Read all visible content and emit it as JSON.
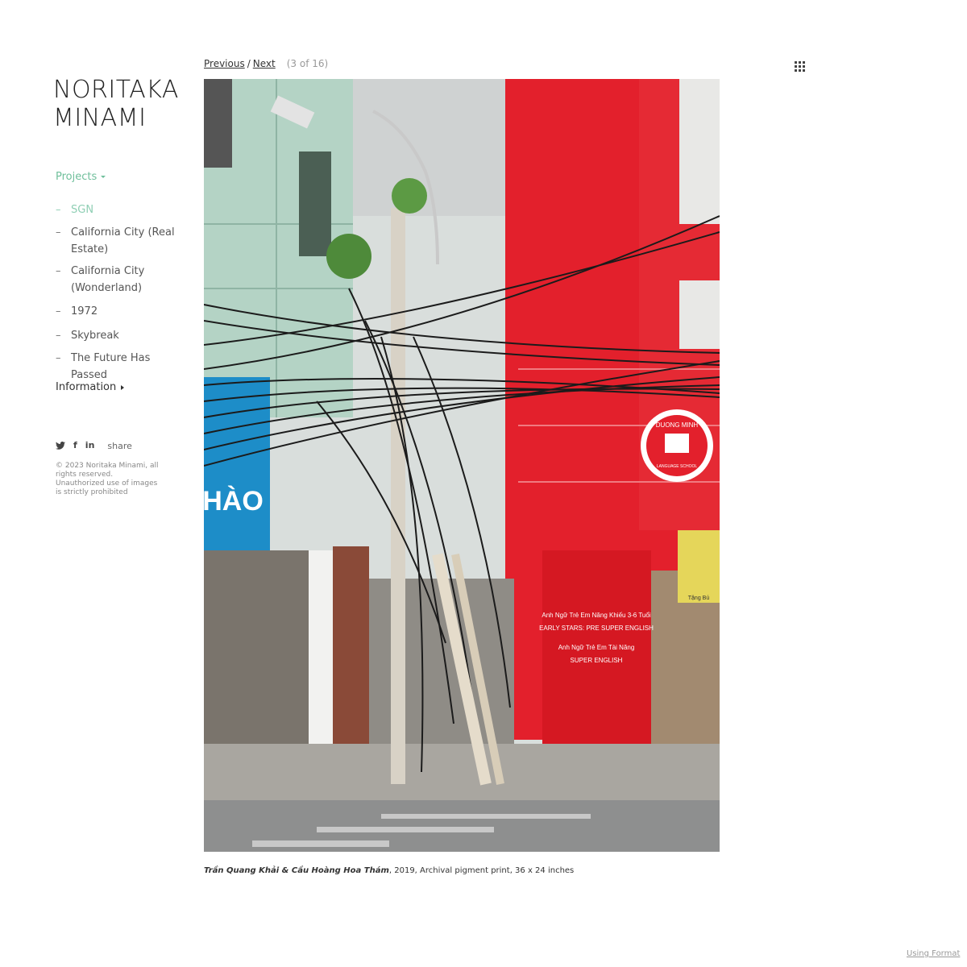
{
  "site": {
    "title_line1": "NORITAKA",
    "title_line2": "MINAMI"
  },
  "nav": {
    "projects_label": "Projects",
    "items": [
      {
        "label": "SGN",
        "active": true
      },
      {
        "label": "California City (Real Estate)",
        "active": false
      },
      {
        "label": "California City (Wonderland)",
        "active": false
      },
      {
        "label": "1972",
        "active": false
      },
      {
        "label": "Skybreak",
        "active": false
      },
      {
        "label": "The Future Has Passed",
        "active": false
      }
    ],
    "dash": "–",
    "information_label": "Information"
  },
  "social": {
    "icons": [
      "twitter-icon",
      "facebook-icon",
      "linkedin-icon"
    ],
    "facebook_glyph": "f",
    "linkedin_glyph": "in",
    "share_label": "share"
  },
  "copyright": "© 2023 Noritaka Minami, all rights reserved. Unauthorized use of images is strictly prohibited",
  "pager": {
    "previous": "Previous",
    "separator": "/",
    "next": "Next",
    "count": "(3 of 16)"
  },
  "caption": {
    "title": "Trần Quang Khải & Cầu Hoàng Hoa Thám",
    "details": ", 2019, Archival pigment print, 36 x 24 inches"
  },
  "photo_signage": {
    "round_sign_top": "DUONG MINH",
    "round_sign_bottom": "LANGUAGE SCHOOL",
    "red_sign_line1": "Anh Ngữ Trẻ Em Năng Khiếu 3-6 Tuổi",
    "red_sign_line2": "EARLY STARS: PRE SUPER ENGLISH",
    "red_sign_line3": "Anh Ngữ Trẻ Em Tài Năng",
    "red_sign_line4": "SUPER ENGLISH",
    "blue_sign_text": "HÀO",
    "banner_text": "Tặng Bú"
  },
  "footer": {
    "using_format": "Using Format"
  },
  "colors": {
    "accent": "#6fbf9b",
    "accent_active": "#8fcfb4",
    "building_red": "#e3202c",
    "building_green": "#b4d3c5",
    "sky": "#d9dedc"
  }
}
